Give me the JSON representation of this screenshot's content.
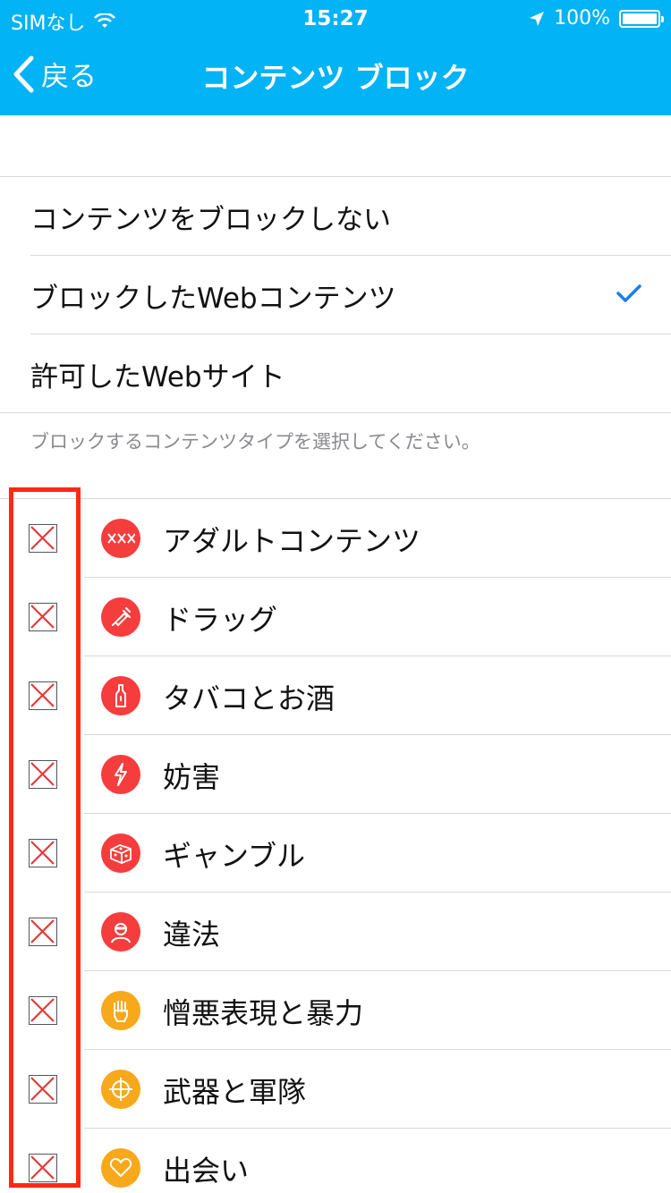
{
  "status_bar": {
    "carrier": "SIMなし",
    "time": "15:27",
    "battery": "100%",
    "battery_level": 1.0
  },
  "nav": {
    "back_label": "戻る",
    "title": "コンテンツ ブロック"
  },
  "options": [
    {
      "label": "コンテンツをブロックしない",
      "selected": false
    },
    {
      "label": "ブロックしたWebコンテンツ",
      "selected": true
    },
    {
      "label": "許可したWebサイト",
      "selected": false
    }
  ],
  "hint": "ブロックするコンテンツタイプを選択してください。",
  "categories": [
    {
      "label": "アダルトコンテンツ",
      "icon": "adult-icon",
      "color": "#f53d3d"
    },
    {
      "label": "ドラッグ",
      "icon": "syringe-icon",
      "color": "#f53d3d"
    },
    {
      "label": "タバコとお酒",
      "icon": "bottle-icon",
      "color": "#f53d3d"
    },
    {
      "label": "妨害",
      "icon": "lightning-icon",
      "color": "#f53d3d"
    },
    {
      "label": "ギャンブル",
      "icon": "dice-icon",
      "color": "#f53d3d"
    },
    {
      "label": "違法",
      "icon": "thief-icon",
      "color": "#f53d3d"
    },
    {
      "label": "憎悪表現と暴力",
      "icon": "fist-icon",
      "color": "#f8a81b"
    },
    {
      "label": "武器と軍隊",
      "icon": "crosshair-icon",
      "color": "#f8a81b"
    },
    {
      "label": "出会い",
      "icon": "heart-icon",
      "color": "#f8a81b"
    }
  ],
  "colors": {
    "nav_bg": "#02b3f5",
    "accent_check": "#1a7cf5",
    "highlight": "#ff2a14",
    "checkbox_x": "#e23b3b"
  }
}
